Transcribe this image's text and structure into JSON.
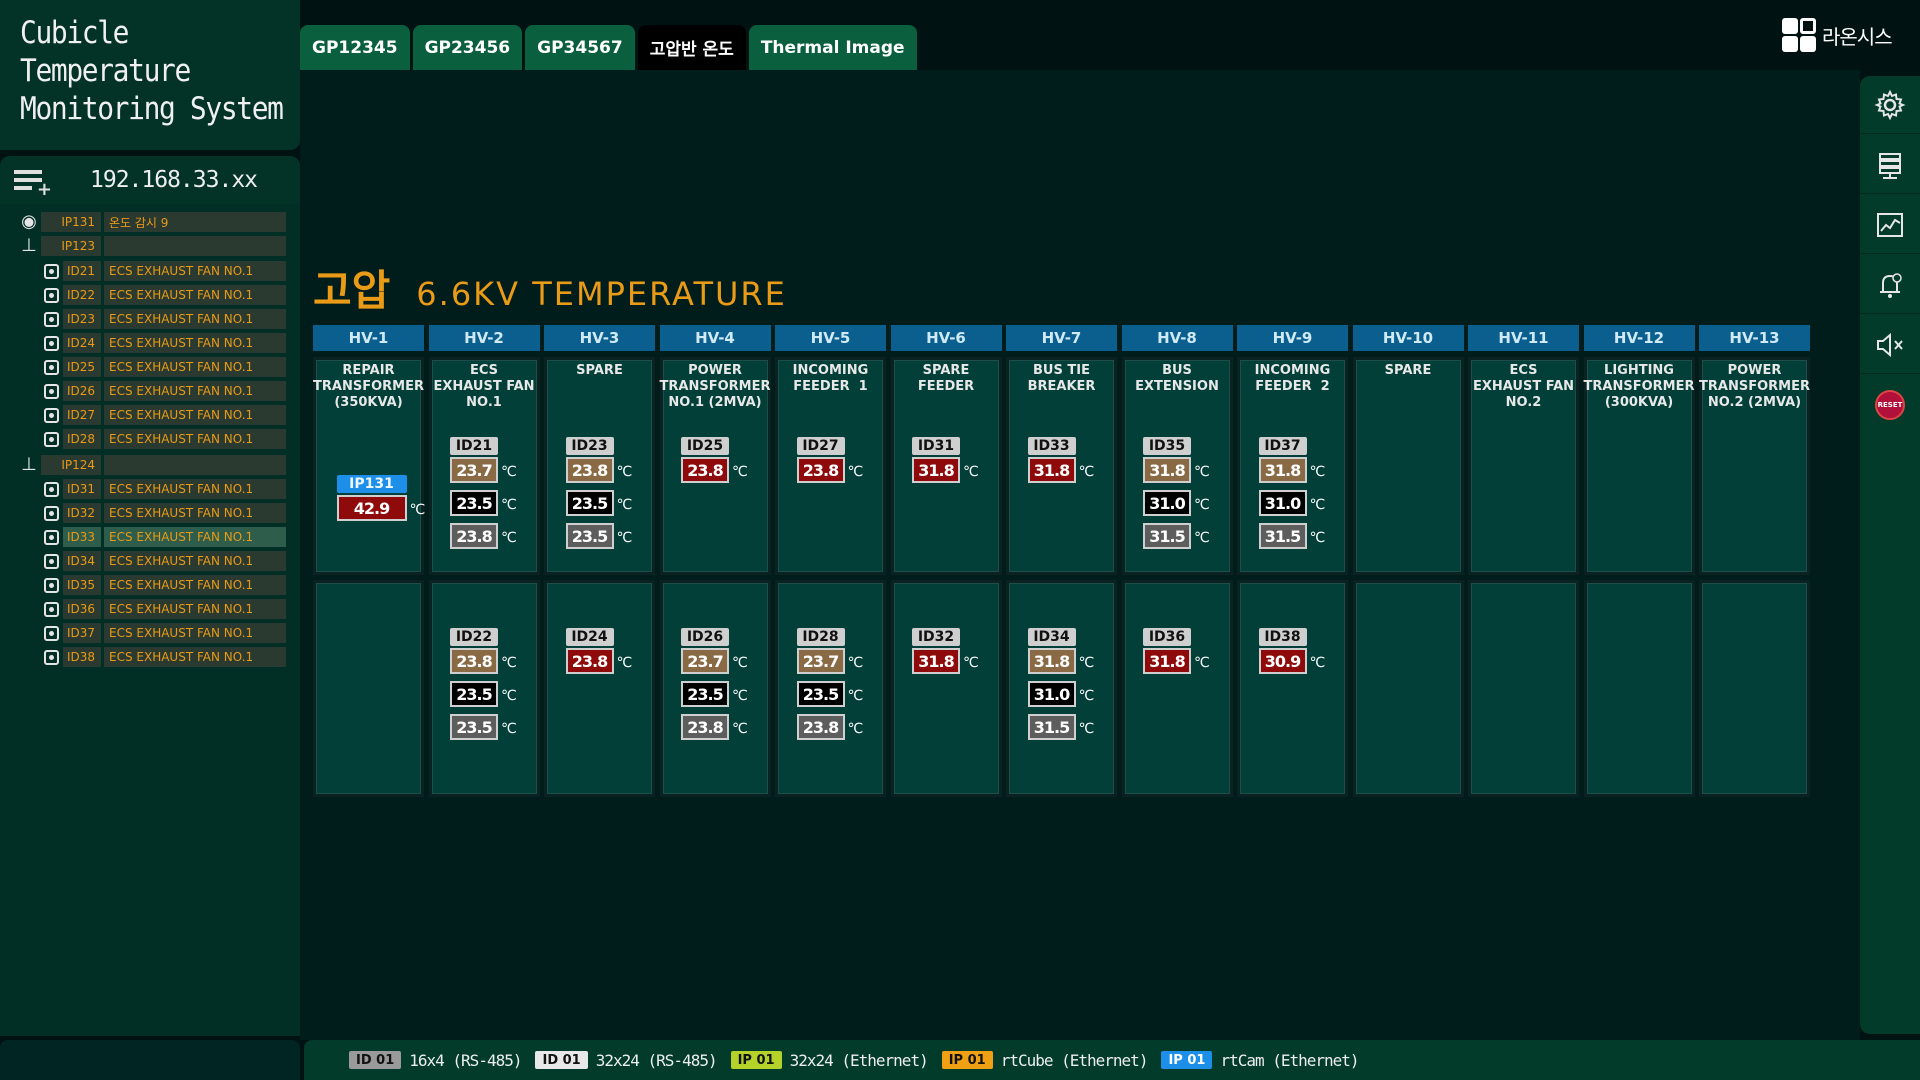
{
  "app": {
    "title_lines": [
      "Cubicle",
      "Temperature",
      "Monitoring System"
    ]
  },
  "tabs": [
    {
      "label": "GP12345",
      "active": false
    },
    {
      "label": "GP23456",
      "active": false
    },
    {
      "label": "GP34567",
      "active": false
    },
    {
      "label": "고압반 온도",
      "active": true
    },
    {
      "label": "Thermal Image",
      "active": false
    }
  ],
  "logo": {
    "text": "라온시스"
  },
  "sidebar": {
    "ip_address": "192.168.33.xx",
    "tree": [
      {
        "icon": "location-pin-icon",
        "code": "IP131",
        "label": "온도 감시 9",
        "indent": 0
      },
      {
        "icon": "network-icon",
        "code": "IP123",
        "label": "",
        "indent": 0
      },
      {
        "icon": "sensor-icon",
        "code": "ID21",
        "label": "ECS EXHAUST FAN NO.1",
        "indent": 1
      },
      {
        "icon": "sensor-icon",
        "code": "ID22",
        "label": "ECS EXHAUST FAN NO.1",
        "indent": 1
      },
      {
        "icon": "sensor-icon",
        "code": "ID23",
        "label": "ECS EXHAUST FAN NO.1",
        "indent": 1
      },
      {
        "icon": "sensor-icon",
        "code": "ID24",
        "label": "ECS EXHAUST FAN NO.1",
        "indent": 1
      },
      {
        "icon": "sensor-icon",
        "code": "ID25",
        "label": "ECS EXHAUST FAN NO.1",
        "indent": 1
      },
      {
        "icon": "sensor-icon",
        "code": "ID26",
        "label": "ECS EXHAUST FAN NO.1",
        "indent": 1
      },
      {
        "icon": "sensor-icon",
        "code": "ID27",
        "label": "ECS EXHAUST FAN NO.1",
        "indent": 1
      },
      {
        "icon": "sensor-icon",
        "code": "ID28",
        "label": "ECS EXHAUST FAN NO.1",
        "indent": 1
      },
      {
        "icon": "network-icon",
        "code": "IP124",
        "label": "",
        "indent": 0
      },
      {
        "icon": "sensor-icon",
        "code": "ID31",
        "label": "ECS EXHAUST FAN NO.1",
        "indent": 1
      },
      {
        "icon": "sensor-icon",
        "code": "ID32",
        "label": "ECS EXHAUST FAN NO.1",
        "indent": 1
      },
      {
        "icon": "sensor-icon",
        "code": "ID33",
        "label": "ECS EXHAUST FAN NO.1",
        "indent": 1,
        "selected": true
      },
      {
        "icon": "sensor-icon",
        "code": "ID34",
        "label": "ECS EXHAUST FAN NO.1",
        "indent": 1
      },
      {
        "icon": "sensor-icon",
        "code": "ID35",
        "label": "ECS EXHAUST FAN NO.1",
        "indent": 1
      },
      {
        "icon": "sensor-icon",
        "code": "ID36",
        "label": "ECS EXHAUST FAN NO.1",
        "indent": 1
      },
      {
        "icon": "sensor-icon",
        "code": "ID37",
        "label": "ECS EXHAUST FAN NO.1",
        "indent": 1
      },
      {
        "icon": "sensor-icon",
        "code": "ID38",
        "label": "ECS EXHAUST FAN NO.1",
        "indent": 1
      }
    ]
  },
  "right_rail": {
    "buttons": [
      {
        "name": "settings-button",
        "icon": "gear-icon"
      },
      {
        "name": "server-button",
        "icon": "server-icon"
      },
      {
        "name": "trend-chart-button",
        "icon": "chart-icon"
      },
      {
        "name": "alarm-bell-button",
        "icon": "bell-icon"
      },
      {
        "name": "mute-button",
        "icon": "speaker-mute-icon"
      },
      {
        "name": "reset-button",
        "icon": "reset-icon",
        "label": "RESET"
      }
    ]
  },
  "hv": {
    "title_ko": "고압",
    "title_en": "6.6KV TEMPERATURE",
    "unit": "℃",
    "colors": {
      "red": "#8f0b0b",
      "tan": "#8a6a45",
      "black": "#000000",
      "gray": "#5d5d5d",
      "ip_blue": "#1e8fe8",
      "header_blue": "#0a5f8e"
    },
    "columns": [
      {
        "head": "HV-1",
        "name": [
          "REPAIR",
          "TRANSFORMER",
          "(350KVA)"
        ],
        "top": [
          {
            "tag": "IP131",
            "kind": "ip",
            "temps": [
              {
                "v": "42.9",
                "c": "red"
              }
            ]
          }
        ],
        "bottom": []
      },
      {
        "head": "HV-2",
        "name": [
          "ECS",
          "EXHAUST FAN",
          "NO.1"
        ],
        "top": [
          {
            "tag": "ID21",
            "kind": "id",
            "temps": [
              {
                "v": "23.7",
                "c": "tan"
              },
              {
                "v": "23.5",
                "c": "blk"
              },
              {
                "v": "23.8",
                "c": "gry"
              }
            ]
          }
        ],
        "bottom": [
          {
            "tag": "ID22",
            "kind": "id",
            "temps": [
              {
                "v": "23.8",
                "c": "tan"
              },
              {
                "v": "23.5",
                "c": "blk"
              },
              {
                "v": "23.5",
                "c": "gry"
              }
            ]
          }
        ]
      },
      {
        "head": "HV-3",
        "name": [
          "SPARE"
        ],
        "top": [
          {
            "tag": "ID23",
            "kind": "id",
            "temps": [
              {
                "v": "23.8",
                "c": "tan"
              },
              {
                "v": "23.5",
                "c": "blk"
              },
              {
                "v": "23.5",
                "c": "gry"
              }
            ]
          }
        ],
        "bottom": [
          {
            "tag": "ID24",
            "kind": "id",
            "temps": [
              {
                "v": "23.8",
                "c": "red"
              }
            ]
          }
        ]
      },
      {
        "head": "HV-4",
        "name": [
          "POWER",
          "TRANSFORMER",
          "NO.1 (2MVA)"
        ],
        "top": [
          {
            "tag": "ID25",
            "kind": "id",
            "temps": [
              {
                "v": "23.8",
                "c": "red"
              }
            ]
          }
        ],
        "bottom": [
          {
            "tag": "ID26",
            "kind": "id",
            "temps": [
              {
                "v": "23.7",
                "c": "tan"
              },
              {
                "v": "23.5",
                "c": "blk"
              },
              {
                "v": "23.8",
                "c": "gry"
              }
            ]
          }
        ]
      },
      {
        "head": "HV-5",
        "name": [
          "INCOMING",
          "FEEDER  1"
        ],
        "top": [
          {
            "tag": "ID27",
            "kind": "id",
            "temps": [
              {
                "v": "23.8",
                "c": "red"
              }
            ]
          }
        ],
        "bottom": [
          {
            "tag": "ID28",
            "kind": "id",
            "temps": [
              {
                "v": "23.7",
                "c": "tan"
              },
              {
                "v": "23.5",
                "c": "blk"
              },
              {
                "v": "23.8",
                "c": "gry"
              }
            ]
          }
        ]
      },
      {
        "head": "HV-6",
        "name": [
          "SPARE",
          "FEEDER"
        ],
        "top": [
          {
            "tag": "ID31",
            "kind": "id",
            "temps": [
              {
                "v": "31.8",
                "c": "red"
              }
            ]
          }
        ],
        "bottom": [
          {
            "tag": "ID32",
            "kind": "id",
            "temps": [
              {
                "v": "31.8",
                "c": "red"
              }
            ]
          }
        ]
      },
      {
        "head": "HV-7",
        "name": [
          "BUS TIE",
          "BREAKER"
        ],
        "top": [
          {
            "tag": "ID33",
            "kind": "id",
            "temps": [
              {
                "v": "31.8",
                "c": "red"
              }
            ]
          }
        ],
        "bottom": [
          {
            "tag": "ID34",
            "kind": "id",
            "temps": [
              {
                "v": "31.8",
                "c": "tan"
              },
              {
                "v": "31.0",
                "c": "blk"
              },
              {
                "v": "31.5",
                "c": "gry"
              }
            ]
          }
        ]
      },
      {
        "head": "HV-8",
        "name": [
          "BUS",
          "EXTENSION"
        ],
        "top": [
          {
            "tag": "ID35",
            "kind": "id",
            "temps": [
              {
                "v": "31.8",
                "c": "tan"
              },
              {
                "v": "31.0",
                "c": "blk"
              },
              {
                "v": "31.5",
                "c": "gry"
              }
            ]
          }
        ],
        "bottom": [
          {
            "tag": "ID36",
            "kind": "id",
            "temps": [
              {
                "v": "31.8",
                "c": "red"
              }
            ]
          }
        ]
      },
      {
        "head": "HV-9",
        "name": [
          "INCOMING",
          "FEEDER  2"
        ],
        "top": [
          {
            "tag": "ID37",
            "kind": "id",
            "temps": [
              {
                "v": "31.8",
                "c": "tan"
              },
              {
                "v": "31.0",
                "c": "blk"
              },
              {
                "v": "31.5",
                "c": "gry"
              }
            ]
          }
        ],
        "bottom": [
          {
            "tag": "ID38",
            "kind": "id",
            "temps": [
              {
                "v": "30.9",
                "c": "red"
              }
            ]
          }
        ]
      },
      {
        "head": "HV-10",
        "name": [
          "SPARE"
        ],
        "top": [],
        "bottom": []
      },
      {
        "head": "HV-11",
        "name": [
          "ECS",
          "EXHAUST FAN",
          "NO.2"
        ],
        "top": [],
        "bottom": []
      },
      {
        "head": "HV-12",
        "name": [
          "LIGHTING",
          "TRANSFORMER",
          "(300KVA)"
        ],
        "top": [],
        "bottom": []
      },
      {
        "head": "HV-13",
        "name": [
          "POWER",
          "TRANSFORMER",
          "NO.2 (2MVA)"
        ],
        "top": [],
        "bottom": []
      }
    ]
  },
  "legend": [
    {
      "chip": "ID 01",
      "chip_bg": "#9a9a9a",
      "chip_fg": "#111111",
      "text": "16x4 (RS-485)"
    },
    {
      "chip": "ID 01",
      "chip_bg": "#e8e8e8",
      "chip_fg": "#111111",
      "text": "32x24 (RS-485)"
    },
    {
      "chip": "IP 01",
      "chip_bg": "#b5d22a",
      "chip_fg": "#111111",
      "text": "32x24 (Ethernet)"
    },
    {
      "chip": "IP 01",
      "chip_bg": "#f0a013",
      "chip_fg": "#111111",
      "text": "rtCube (Ethernet)"
    },
    {
      "chip": "IP 01",
      "chip_bg": "#1e8fe8",
      "chip_fg": "#ffffff",
      "text": "rtCam (Ethernet)"
    }
  ]
}
